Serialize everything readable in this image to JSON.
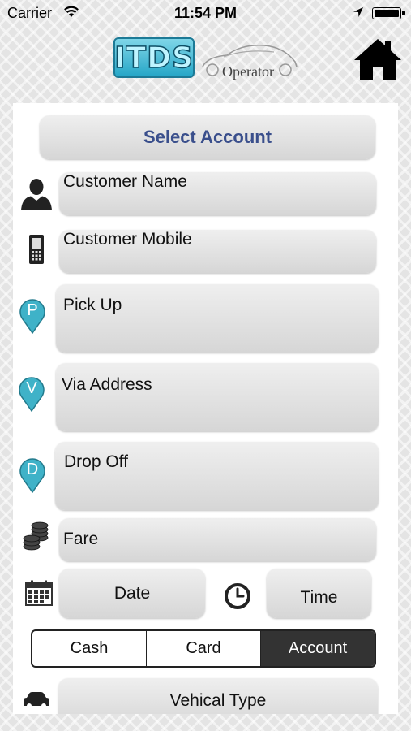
{
  "status_bar": {
    "carrier": "Carrier",
    "time": "11:54 PM"
  },
  "header": {
    "logo_text": "ITDS",
    "sub_logo_text": "Operator"
  },
  "form": {
    "select_account": "Select Account",
    "customer_name": "Customer Name",
    "customer_mobile": "Customer Mobile",
    "pick_up": "Pick Up",
    "via_address": "Via Address",
    "drop_off": "Drop Off",
    "fare": "Fare",
    "date": "Date",
    "time": "Time",
    "vehicle_type": "Vehical Type",
    "pin_letters": {
      "pickup": "P",
      "via": "V",
      "dropoff": "D"
    }
  },
  "payment": {
    "options": [
      "Cash",
      "Card",
      "Account"
    ],
    "selected": "Account"
  },
  "icons": {
    "home": "home-icon",
    "person": "person-icon",
    "mobile": "mobile-phone-icon",
    "coins": "coins-icon",
    "calendar": "calendar-icon",
    "clock": "clock-icon",
    "car": "car-icon"
  },
  "colors": {
    "select_account_text": "#3a4f8c",
    "pin": "#3fb2c8",
    "segment_active": "#333333"
  }
}
